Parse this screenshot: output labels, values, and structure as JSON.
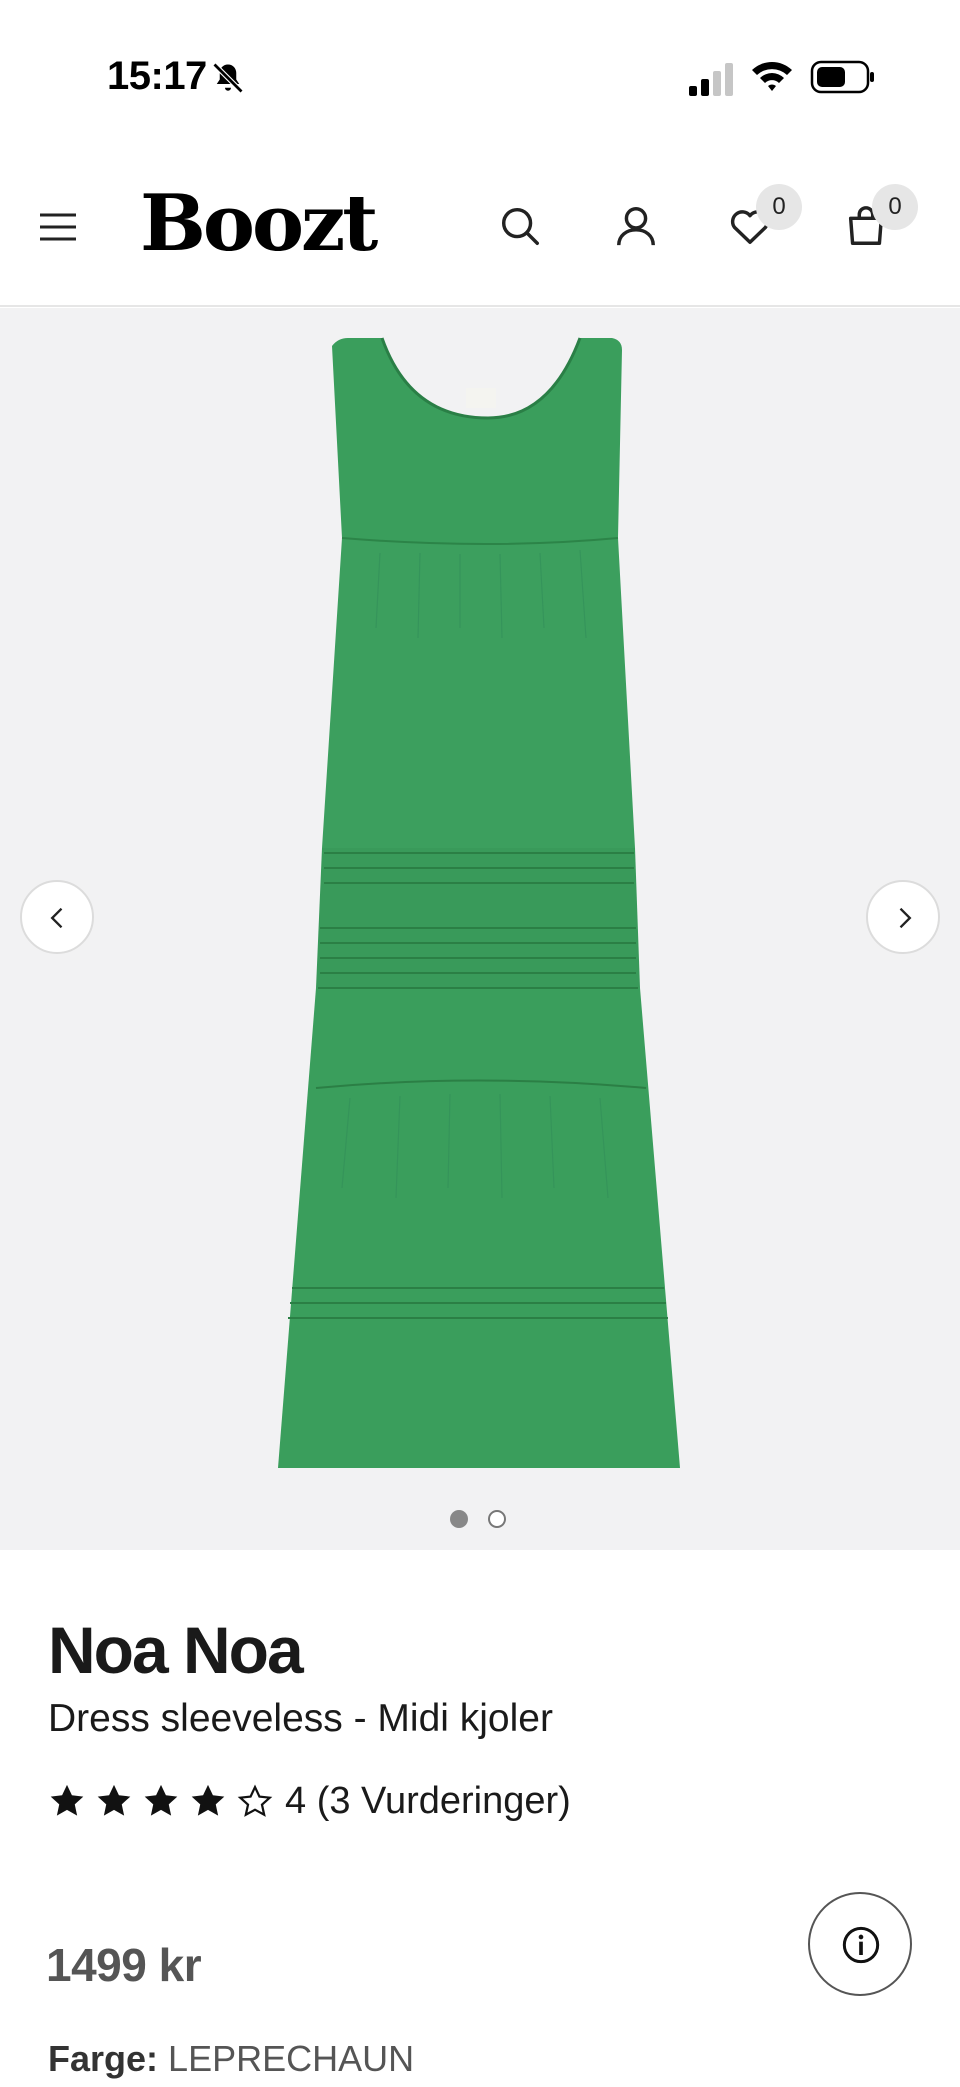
{
  "status_bar": {
    "time": "15:17"
  },
  "header": {
    "logo": "Boozt",
    "wishlist_count": "0",
    "cart_count": "0"
  },
  "gallery": {
    "image_alt": "green sleeveless dress",
    "image_color": "#3a9e5c",
    "total_images": 2,
    "current_image": 1
  },
  "product": {
    "brand": "Noa Noa",
    "name": "Dress sleeveless - Midi kjoler",
    "rating_value": 4,
    "rating_max": 5,
    "rating_text": "4 (3 Vurderinger)",
    "price": "1499 kr",
    "color_label": "Farge:",
    "color_value": "LEPRECHAUN"
  },
  "colors": {
    "accent": "#000000",
    "badge_bg": "#e6e6e6",
    "gallery_bg": "#f2f2f3"
  }
}
